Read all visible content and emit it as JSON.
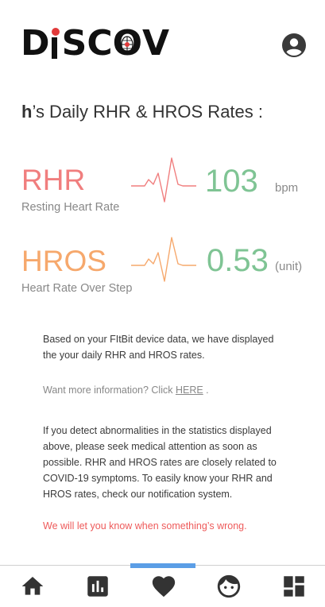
{
  "header": {
    "logo": {
      "part1": "D",
      "letter_i": "i",
      "part2": "SC",
      "letter_o": "O",
      "part3": "V"
    },
    "avatar_icon": "account-circle-icon"
  },
  "title": {
    "user": "h",
    "text": "’s Daily RHR & HROS Rates :"
  },
  "rhr": {
    "label": "RHR",
    "subtitle": "Resting Heart Rate",
    "value": "103",
    "unit": "bpm",
    "color": "#f07e7e",
    "pulse_icon": "heartbeat-pulse-icon"
  },
  "hros": {
    "label": "HROS",
    "subtitle": "Heart Rate Over Step",
    "value": "0.53",
    "unit": "(unit)",
    "color": "#f6a86c",
    "pulse_icon": "heartbeat-pulse-icon"
  },
  "info": {
    "paragraph1": "Based on your FItBit device data, we have displayed the your daily RHR and HROS rates.",
    "more_prefix": "Want more information? Click ",
    "more_link": "HERE",
    "more_suffix": " .",
    "paragraph2": "If you detect abnormalities in the statistics displayed above, please seek medical attention as soon as possible. RHR and HROS rates are closely related to COVID-19 symptoms. To easily know your RHR and HROS rates, check our notification system.",
    "warning": "We will let you know when something’s wrong."
  },
  "bottom_nav": {
    "items": [
      "home-icon",
      "bar-chart-icon",
      "heart-icon",
      "face-icon",
      "dashboard-icon"
    ],
    "active_index": 2,
    "active_color": "#5b9ee6"
  },
  "value_color": "#7fc494"
}
